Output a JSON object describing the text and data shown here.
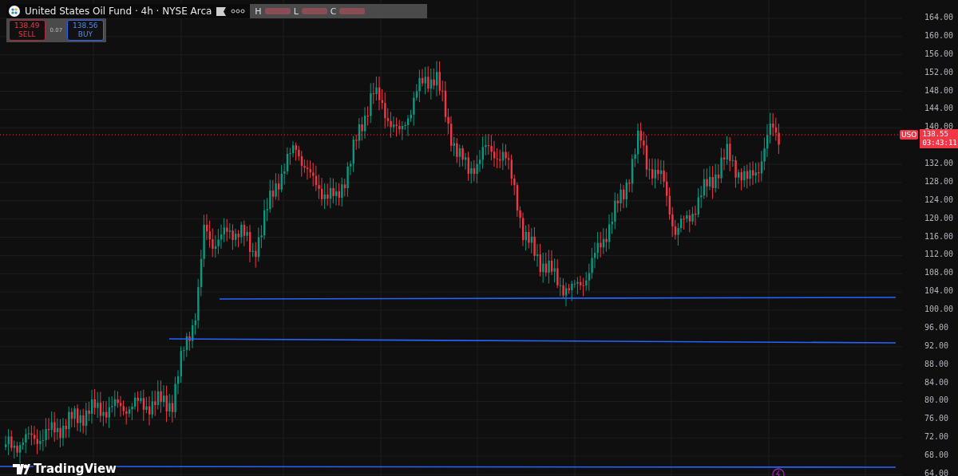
{
  "header": {
    "title": "United States Oil Fund · 4h · NYSE Arca",
    "ohlc_labels": [
      "H",
      "L",
      "C"
    ]
  },
  "trade": {
    "sell": {
      "price": "138.49",
      "label": "SELL"
    },
    "spread": "0.07",
    "buy": {
      "price": "138.56",
      "label": "BUY"
    }
  },
  "price_axis": {
    "ticks": [
      "164.00",
      "160.00",
      "156.00",
      "152.00",
      "148.00",
      "144.00",
      "140.00",
      "132.00",
      "128.00",
      "124.00",
      "120.00",
      "116.00",
      "112.00",
      "108.00",
      "104.00",
      "100.00",
      "96.00",
      "92.00",
      "88.00",
      "84.00",
      "80.00",
      "76.00",
      "72.00",
      "68.00",
      "64.00"
    ]
  },
  "last_price": {
    "symbol": "USO",
    "price": "138.55",
    "countdown": "03:43:11"
  },
  "logo": "TradingView"
}
